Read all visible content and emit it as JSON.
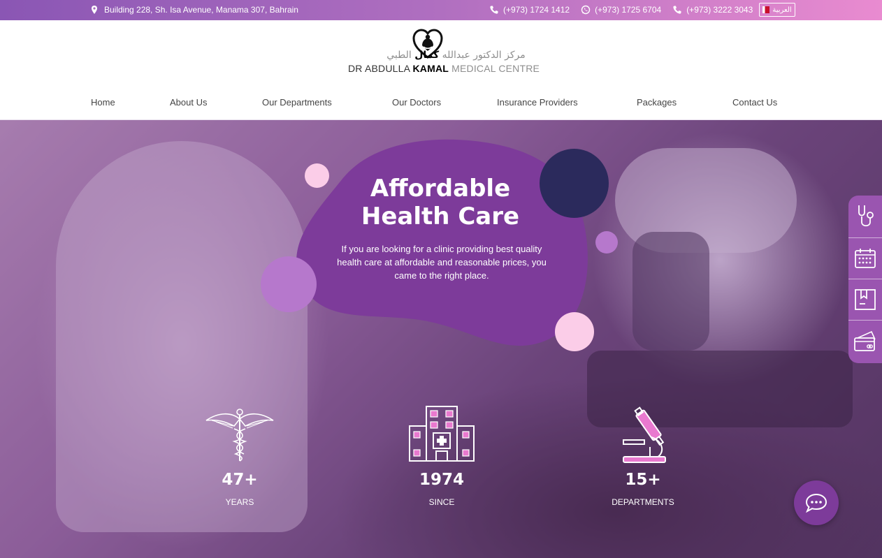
{
  "topbar": {
    "address": "Building 228, Sh. Isa Avenue, Manama 307, Bahrain",
    "phones": [
      {
        "type": "phone",
        "number": "(+973) 1724 1412"
      },
      {
        "type": "whatsapp",
        "number": "(+973) 1725 6704"
      },
      {
        "type": "phone",
        "number": "(+973) 3222 3043"
      }
    ],
    "language_label": "العربية"
  },
  "logo": {
    "arabic_prefix": "مركز الدكتور عبدالله",
    "arabic_bold": "كمال",
    "arabic_suffix": "الطبي",
    "en_prefix": "DR ABDULLA",
    "en_bold": "KAMAL",
    "en_suffix": "MEDICAL CENTRE"
  },
  "nav": [
    {
      "label": "Home"
    },
    {
      "label": "About Us"
    },
    {
      "label": "Our Departments"
    },
    {
      "label": "Our Doctors"
    },
    {
      "label": "Insurance Providers"
    },
    {
      "label": "Packages"
    },
    {
      "label": "Contact Us"
    }
  ],
  "hero": {
    "title_line1": "Affordable",
    "title_line2": "Health Care",
    "subtitle": "If you are looking for a clinic providing best quality health care at affordable and reasonable prices, you came to the right place."
  },
  "stats": [
    {
      "icon": "caduceus-icon",
      "value": "47+",
      "label": "YEARS"
    },
    {
      "icon": "hospital-icon",
      "value": "1974",
      "label": "SINCE"
    },
    {
      "icon": "microscope-icon",
      "value": "15+",
      "label": "DEPARTMENTS"
    }
  ],
  "sidebar_icons": [
    "stethoscope-icon",
    "calendar-icon",
    "booking-icon",
    "payment-card-icon"
  ],
  "colors": {
    "brand_purple": "#7d3b9a",
    "accent_pink": "#e98bd0",
    "navy": "#2b2a5c",
    "light_pink": "#fbcde8",
    "lilac": "#b678cc"
  }
}
